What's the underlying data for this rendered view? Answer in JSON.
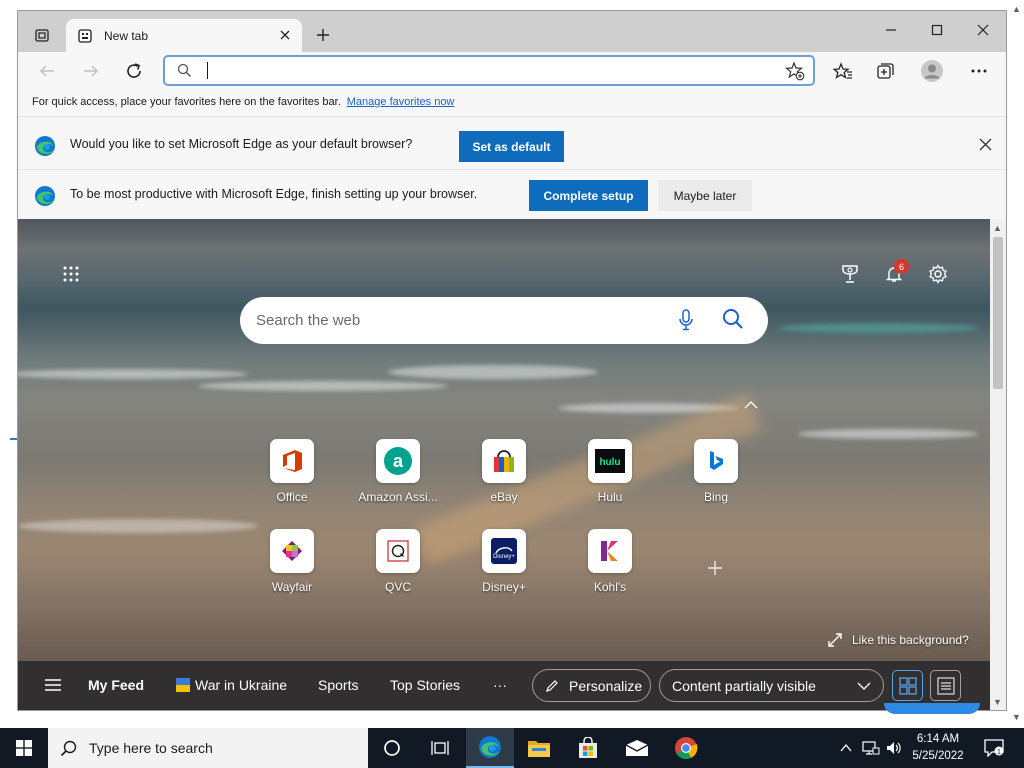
{
  "browser": {
    "tab": {
      "title": "New tab"
    },
    "address": {
      "value": ""
    },
    "favorites_hint": {
      "text": "For quick access, place your favorites here on the favorites bar.",
      "link": "Manage favorites now"
    },
    "default_prompt": {
      "message": "Would you like to set Microsoft Edge as your default browser?",
      "button": "Set as default"
    },
    "setup_prompt": {
      "message": "To be most productive with Microsoft Edge, finish setting up your browser.",
      "primary": "Complete setup",
      "secondary": "Maybe later"
    }
  },
  "ntp": {
    "search_placeholder": "Search the web",
    "notifications_count": "6",
    "tiles": [
      {
        "label": "Office",
        "icon": "office-icon",
        "color": "#d83b01"
      },
      {
        "label": "Amazon Assi...",
        "icon": "amazon-icon",
        "color": "#00a38d"
      },
      {
        "label": "eBay",
        "icon": "ebay-icon",
        "color": "#e53238"
      },
      {
        "label": "Hulu",
        "icon": "hulu-icon",
        "color": "#1ce783"
      },
      {
        "label": "Bing",
        "icon": "bing-icon",
        "color": "#0078d4"
      },
      {
        "label": "Wayfair",
        "icon": "wayfair-icon",
        "color": "#7f187f"
      },
      {
        "label": "QVC",
        "icon": "qvc-icon",
        "color": "#d2232a"
      },
      {
        "label": "Disney+",
        "icon": "disney-icon",
        "color": "#0b1d63"
      },
      {
        "label": "Kohl's",
        "icon": "kohls-icon",
        "color": "#7b2d8f"
      }
    ],
    "like_background": "Like this background?",
    "feed": {
      "my_feed": "My Feed",
      "war_in_ukraine": "War in Ukraine",
      "sports": "Sports",
      "top_stories": "Top Stories",
      "more": "···",
      "personalize": "Personalize",
      "content_visibility": "Content partially visible"
    }
  },
  "taskbar": {
    "search_placeholder": "Type here to search",
    "time": "6:14 AM",
    "date": "5/25/2022",
    "notification_count": "1"
  },
  "colors": {
    "accent": "#0f6cbd",
    "edge_blue": "#0f78d4",
    "edge_green": "#45c36b",
    "taskbar": "#111a24"
  }
}
